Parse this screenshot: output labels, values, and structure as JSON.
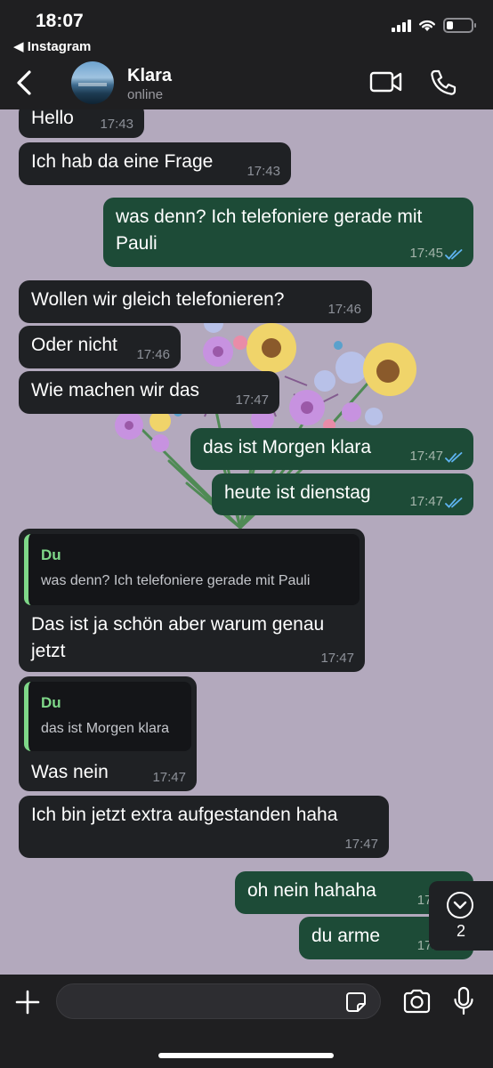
{
  "status_bar": {
    "time": "18:07",
    "back_app": "◀ Instagram"
  },
  "header": {
    "name": "Klara",
    "status": "online"
  },
  "messages": [
    {
      "dir": "in",
      "text": "Hello",
      "time": "17:43"
    },
    {
      "dir": "in",
      "text": "Ich hab da eine Frage",
      "time": "17:43"
    },
    {
      "dir": "out",
      "text": "was denn? Ich telefoniere gerade mit Pauli",
      "time": "17:45",
      "read": true
    },
    {
      "dir": "in",
      "text": "Wollen wir gleich telefonieren?",
      "time": "17:46"
    },
    {
      "dir": "in",
      "text": "Oder nicht",
      "time": "17:46"
    },
    {
      "dir": "in",
      "text": "Wie machen wir das",
      "time": "17:47"
    },
    {
      "dir": "out",
      "text": "das ist Morgen klara",
      "time": "17:47",
      "read": true
    },
    {
      "dir": "out",
      "text": "heute ist dienstag",
      "time": "17:47",
      "read": true
    },
    {
      "dir": "in",
      "quote_name": "Du",
      "quote_text": "was denn? Ich telefoniere gerade mit Pauli",
      "text": "Das ist ja schön aber warum genau jetzt",
      "time": "17:47"
    },
    {
      "dir": "in",
      "quote_name": "Du",
      "quote_text": "das ist Morgen klara",
      "text": "Was nein",
      "time": "17:47"
    },
    {
      "dir": "in",
      "text": "Ich bin jetzt extra aufgestanden haha",
      "time": "17:47"
    },
    {
      "dir": "out",
      "text": "oh nein hahaha",
      "time": "17:4"
    },
    {
      "dir": "out",
      "text": "du arme",
      "time": "17:4"
    }
  ],
  "scroll_down": {
    "unread_count": "2"
  },
  "composer": {
    "placeholder": ""
  },
  "colors": {
    "incoming": "#1f2124",
    "outgoing": "#1d4b37",
    "quote_accent": "#7fd889",
    "wallpaper": "#b3a9bd",
    "read_ticks": "#5eb3f0"
  }
}
